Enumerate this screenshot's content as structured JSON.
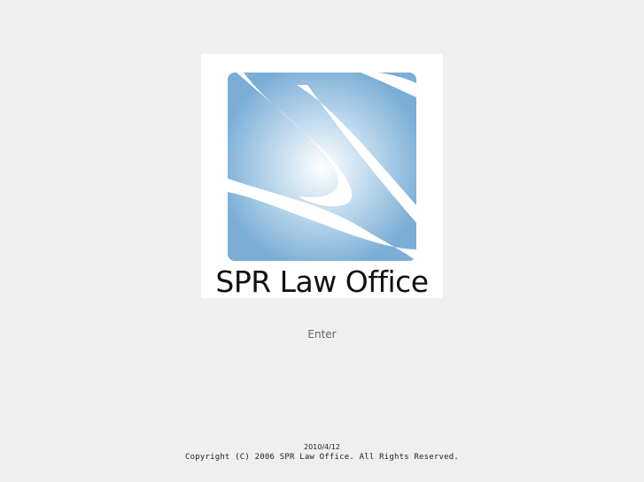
{
  "logo": {
    "text": "SPR Law Office",
    "mark_icon": "spr-s-swoosh-logo",
    "colors": {
      "blue_dark": "#7aaed6",
      "blue_light": "#e8f2fa",
      "text": "#111111"
    }
  },
  "enter": {
    "label": "Enter"
  },
  "footer": {
    "date": "2010/4/12",
    "copyright": "Copyright (C) 2006 SPR Law Office. All Rights Reserved."
  },
  "colors": {
    "background": "#efefef",
    "link_text": "#666666"
  }
}
